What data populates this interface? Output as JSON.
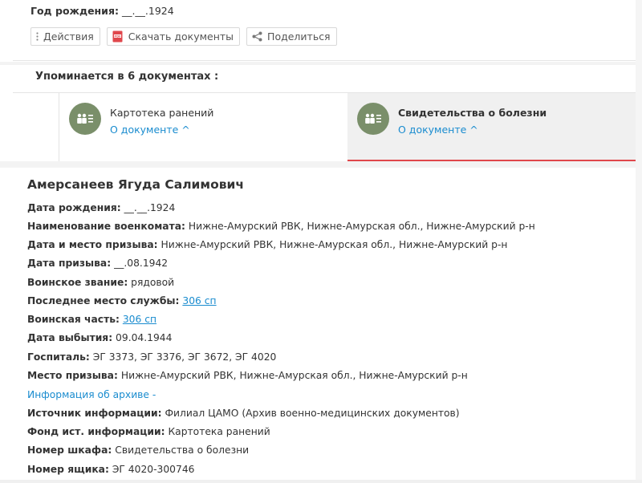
{
  "top": {
    "birth_label": "Год рождения:",
    "birth_value": "__.__.1924",
    "actions_label": "Действия",
    "download_label": "Скачать документы",
    "share_label": "Поделиться"
  },
  "mentions": {
    "title": "Упоминается в 6 документах :",
    "docs": [
      {
        "name": "Картотека ранений",
        "link": "О документе ^"
      },
      {
        "name": "Свидетельства о болезни",
        "link": "О документе ^"
      }
    ]
  },
  "person": {
    "name": "Амерсанеев Ягуда Салимович",
    "fields": [
      {
        "k": "Дата рождения:",
        "v": "__.__.1924"
      },
      {
        "k": "Наименование военкомата:",
        "v": "Нижне-Амурский РВК, Нижне-Амурская обл., Нижне-Амурский р-н"
      },
      {
        "k": "Дата и место призыва:",
        "v": "Нижне-Амурский РВК, Нижне-Амурская обл., Нижне-Амурский р-н"
      },
      {
        "k": "Дата призыва:",
        "v": "__.08.1942"
      },
      {
        "k": "Воинское звание:",
        "v": "рядовой"
      },
      {
        "k": "Последнее место службы:",
        "link": "306 сп"
      },
      {
        "k": "Воинская часть:",
        "link": "306 сп"
      },
      {
        "k": "Дата выбытия:",
        "v": "09.04.1944"
      },
      {
        "k": "Госпиталь:",
        "v": "ЭГ 3373, ЭГ 3376, ЭГ 3672, ЭГ 4020"
      },
      {
        "k": "Место призыва:",
        "v": "Нижне-Амурский РВК, Нижне-Амурская обл., Нижне-Амурский р-н"
      }
    ],
    "archive_link": "Информация об архиве -",
    "archive_fields": [
      {
        "k": "Источник информации:",
        "v": "Филиал ЦАМО (Архив военно-медицинских документов)"
      },
      {
        "k": "Фонд ист. информации:",
        "v": "Картотека ранений"
      },
      {
        "k": "Номер шкафа:",
        "v": "Свидетельства о болезни"
      },
      {
        "k": "Номер ящика:",
        "v": "ЭГ 4020-300746"
      }
    ]
  },
  "icons": {
    "actions": "vertical-dots-icon",
    "download": "pdf-icon",
    "share": "share-icon",
    "doc": "people-list-icon"
  },
  "colors": {
    "link": "#1a8ccf",
    "active_tab_border": "#e0474c",
    "doc_circle": "#7a8f6a",
    "pdf_red": "#e0474c"
  }
}
